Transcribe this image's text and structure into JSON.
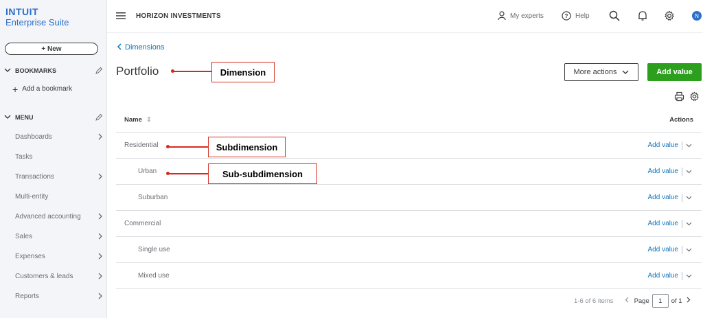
{
  "brand": {
    "line1": "INTUIT",
    "line2": "Enterprise Suite"
  },
  "sidebar": {
    "new_label": "+ New",
    "bookmarks_label": "BOOKMARKS",
    "add_bookmark_label": "Add a bookmark",
    "menu_label": "MENU",
    "items": [
      {
        "label": "Dashboards",
        "has_arrow": true
      },
      {
        "label": "Tasks",
        "has_arrow": false
      },
      {
        "label": "Transactions",
        "has_arrow": true
      },
      {
        "label": "Multi-entity",
        "has_arrow": false
      },
      {
        "label": "Advanced accounting",
        "has_arrow": true
      },
      {
        "label": "Sales",
        "has_arrow": true
      },
      {
        "label": "Expenses",
        "has_arrow": true
      },
      {
        "label": "Customers & leads",
        "has_arrow": true
      },
      {
        "label": "Reports",
        "has_arrow": true
      }
    ]
  },
  "topbar": {
    "company": "HORIZON INVESTMENTS",
    "my_experts": "My experts",
    "help": "Help",
    "avatar_initial": "N",
    "icons": [
      "hamburger-icon",
      "person-icon",
      "help-icon",
      "search-icon",
      "bell-icon",
      "gear-icon"
    ]
  },
  "main": {
    "back_label": "Dimensions",
    "title": "Portfolio",
    "more_actions_label": "More actions",
    "add_value_label": "Add value",
    "table": {
      "col_name": "Name",
      "col_actions": "Actions",
      "rows": [
        {
          "name": "Residential",
          "level": 0,
          "action": "Add value"
        },
        {
          "name": "Urban",
          "level": 1,
          "action": "Add value"
        },
        {
          "name": "Suburban",
          "level": 1,
          "action": "Add value"
        },
        {
          "name": "Commercial",
          "level": 0,
          "action": "Add value"
        },
        {
          "name": "Single use",
          "level": 1,
          "action": "Add value"
        },
        {
          "name": "Mixed use",
          "level": 1,
          "action": "Add value"
        }
      ]
    },
    "pager": {
      "items_text": "1-6 of 6 items",
      "page_label": "Page",
      "page_value": "1",
      "of_text": "of 1"
    }
  },
  "annotations": {
    "dimension": "Dimension",
    "subdimension": "Subdimension",
    "subsubdimension": "Sub-subdimension"
  },
  "colors": {
    "accent_blue": "#0d74ba",
    "brand_blue": "#2b70c9",
    "primary_green": "#2ca01c",
    "callout_red": "#d52b1e"
  }
}
